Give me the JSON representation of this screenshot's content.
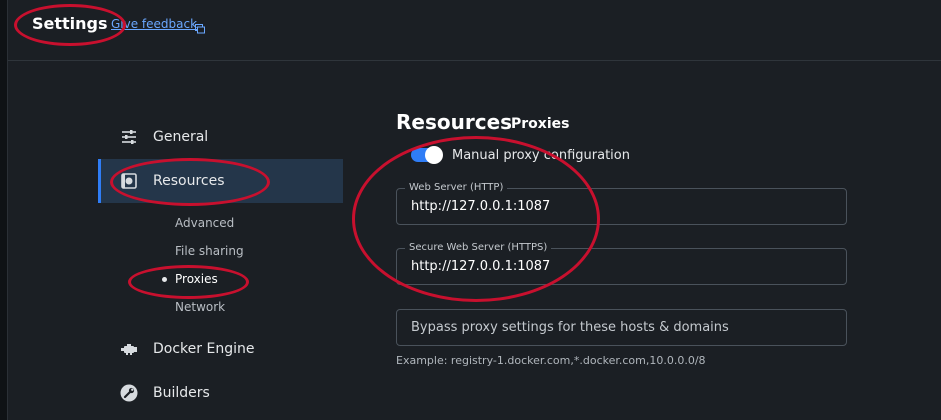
{
  "header": {
    "title": "Settings",
    "feedback_label": "Give feedback"
  },
  "sidebar": {
    "items": [
      {
        "label": "General",
        "icon": "sliders-icon"
      },
      {
        "label": "Resources",
        "icon": "resources-icon",
        "active": true
      },
      {
        "label": "Docker Engine",
        "icon": "engine-icon"
      },
      {
        "label": "Builders",
        "icon": "wrench-icon"
      }
    ],
    "resources_sub": [
      {
        "label": "Advanced"
      },
      {
        "label": "File sharing"
      },
      {
        "label": "Proxies",
        "active": true
      },
      {
        "label": "Network"
      }
    ]
  },
  "main": {
    "title": "Resources",
    "subtitle": "Proxies",
    "manual_proxy": {
      "label": "Manual proxy configuration",
      "enabled": true
    },
    "http": {
      "legend": "Web Server (HTTP)",
      "value": "http://127.0.0.1:1087"
    },
    "https": {
      "legend": "Secure Web Server (HTTPS)",
      "value": "http://127.0.0.1:1087"
    },
    "bypass": {
      "placeholder": "Bypass proxy settings for these hosts & domains",
      "value": ""
    },
    "example": "Example: registry-1.docker.com,*.docker.com,10.0.0.0/8"
  },
  "colors": {
    "accent": "#2f7df6",
    "annotation": "#c8102e",
    "background": "#1b1f24"
  }
}
